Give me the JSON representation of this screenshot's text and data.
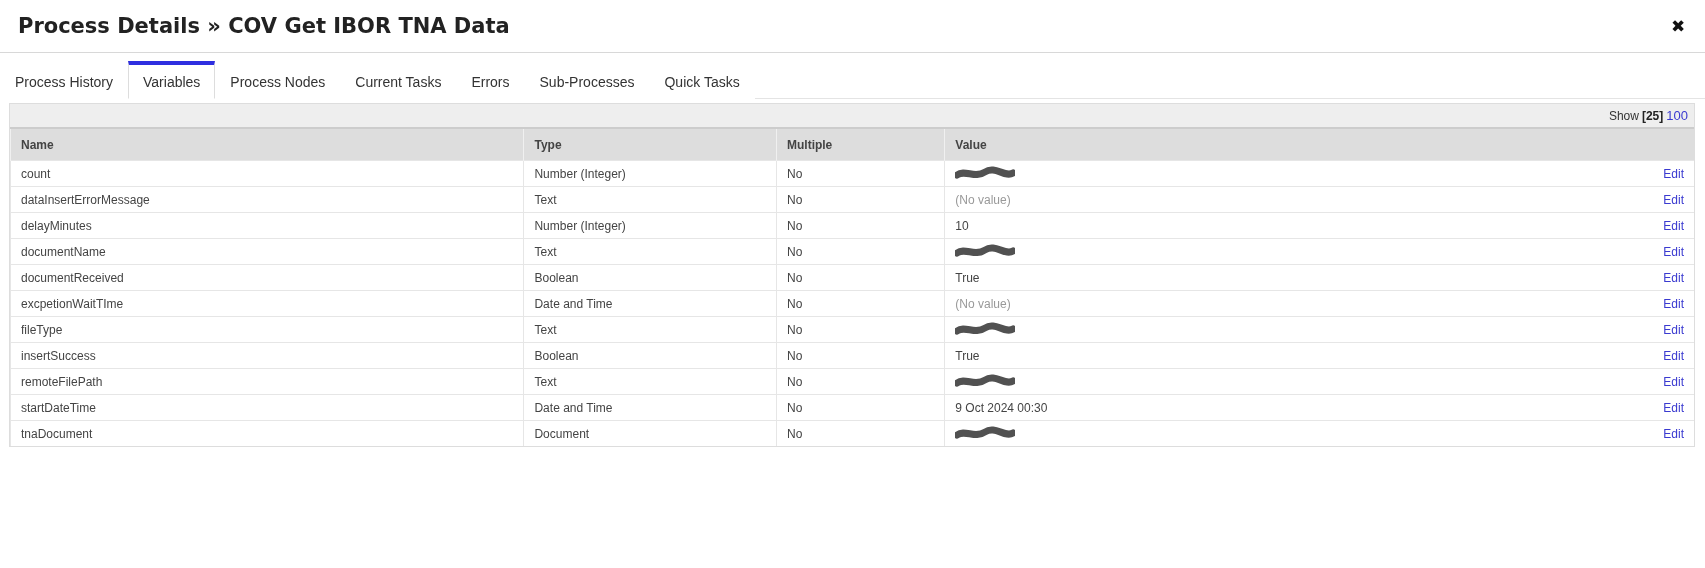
{
  "window": {
    "title": "Process Details » COV Get IBOR TNA Data",
    "close": "✖"
  },
  "tabs": [
    {
      "label": "Process History",
      "selected": false
    },
    {
      "label": "Variables",
      "selected": true
    },
    {
      "label": "Process Nodes",
      "selected": false
    },
    {
      "label": "Current Tasks",
      "selected": false
    },
    {
      "label": "Errors",
      "selected": false
    },
    {
      "label": "Sub-Processes",
      "selected": false
    },
    {
      "label": "Quick Tasks",
      "selected": false
    }
  ],
  "pager": {
    "label": "Show",
    "options": [
      {
        "label": "[25]",
        "selected": true
      },
      {
        "label": "100",
        "selected": false
      }
    ]
  },
  "table": {
    "columns": [
      "Name",
      "Type",
      "Multiple",
      "Value"
    ],
    "rows": [
      {
        "name": "count",
        "type": "Number (Integer)",
        "multiple": "No",
        "value": {
          "kind": "redacted"
        },
        "action": "Edit"
      },
      {
        "name": "dataInsertErrorMessage",
        "type": "Text",
        "multiple": "No",
        "value": {
          "kind": "empty",
          "text": "(No value)"
        },
        "action": "Edit"
      },
      {
        "name": "delayMinutes",
        "type": "Number (Integer)",
        "multiple": "No",
        "value": {
          "kind": "text",
          "text": "10"
        },
        "action": "Edit"
      },
      {
        "name": "documentName",
        "type": "Text",
        "multiple": "No",
        "value": {
          "kind": "redacted"
        },
        "action": "Edit"
      },
      {
        "name": "documentReceived",
        "type": "Boolean",
        "multiple": "No",
        "value": {
          "kind": "text",
          "text": "True"
        },
        "action": "Edit"
      },
      {
        "name": "excpetionWaitTIme",
        "type": "Date and Time",
        "multiple": "No",
        "value": {
          "kind": "empty",
          "text": "(No value)"
        },
        "action": "Edit"
      },
      {
        "name": "fileType",
        "type": "Text",
        "multiple": "No",
        "value": {
          "kind": "redacted"
        },
        "action": "Edit"
      },
      {
        "name": "insertSuccess",
        "type": "Boolean",
        "multiple": "No",
        "value": {
          "kind": "text",
          "text": "True"
        },
        "action": "Edit"
      },
      {
        "name": "remoteFilePath",
        "type": "Text",
        "multiple": "No",
        "value": {
          "kind": "redacted"
        },
        "action": "Edit"
      },
      {
        "name": "startDateTime",
        "type": "Date and Time",
        "multiple": "No",
        "value": {
          "kind": "text",
          "text": "9 Oct 2024 00:30"
        },
        "action": "Edit"
      },
      {
        "name": "tnaDocument",
        "type": "Document",
        "multiple": "No",
        "value": {
          "kind": "redacted"
        },
        "action": "Edit"
      }
    ]
  }
}
